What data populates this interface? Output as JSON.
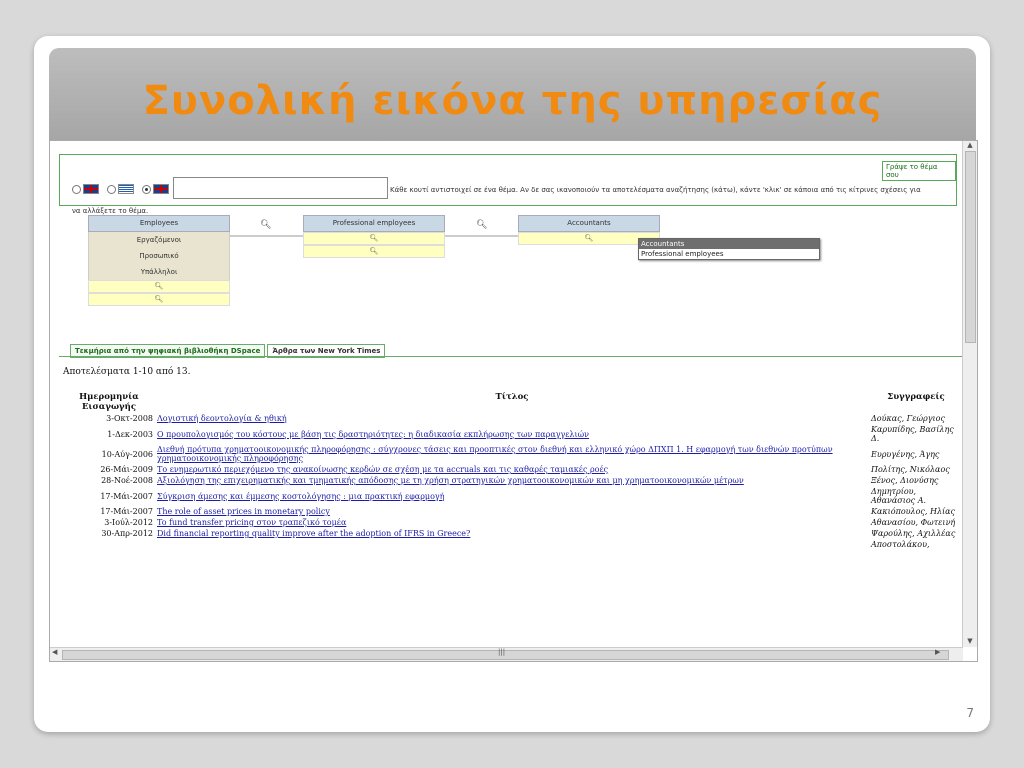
{
  "slide": {
    "title": "Συνολική εικόνα της υπηρεσίας",
    "page_number": "7"
  },
  "search": {
    "write_link": "Γράψε το θέμα σου",
    "instruction_1": "Κάθε κουτί αντιστοιχεί σε ένα θέμα. Αν δε σας ικανοποιούν τα αποτελέσματα αναζήτησης (κάτω), κάντε 'κλικ' σε κάποια από τις κίτρινες σχέσεις για",
    "instruction_2": "να αλλάξετε το θέμα.",
    "input_value": ""
  },
  "concepts": [
    {
      "header": "Employees",
      "terms": [
        "Εργαζόμενοι",
        "Προσωπικό",
        "Υπάλληλοι"
      ]
    },
    {
      "header": "Professional employees",
      "terms": []
    },
    {
      "header": "Accountants",
      "terms": []
    }
  ],
  "tooltip": {
    "title": "Accountants",
    "item": "Professional employees"
  },
  "tabs": [
    "Τεκμήρια από την ψηφιακή βιβλιοθήκη DSpace",
    "Άρθρα των New York Times"
  ],
  "results": {
    "count_text": "Αποτελέσματα 1-10 από 13.",
    "headers": {
      "date": "Ημερομηνία Εισαγωγής",
      "title": "Τίτλος",
      "authors": "Συγγραφείς"
    },
    "rows": [
      {
        "date": "3-Οκτ-2008",
        "title": "Λογιστική δεοντολογία & ηθική",
        "authors": "Δούκας, Γεώργιος"
      },
      {
        "date": "1-Δεκ-2003",
        "title": "Ο προυπολογισμός του κόστους με βάση τις δραστηριότητες: η διαδικασία εκπλήρωσης των παραγγελιών",
        "authors": "Καρυπίδης, Βασίλης Δ."
      },
      {
        "date": "10-Αύγ-2006",
        "title": "Διεθνή πρότυπα χρηματοοικονομικής πληροφόρησης : σύγχρονες τάσεις και προοπτικές στον διεθνή και ελληνικό χώρο ΔΠΧΠ 1. Η εφαρμογή των διεθνών προτύπων χρηματοοικονομικής πληροφόρησης",
        "authors": "Ευρυγένης, Άγης"
      },
      {
        "date": "26-Μάι-2009",
        "title": "Το ενημερωτικό περιεχόμενο της ανακοίνωσης κερδών σε σχέση με τα accruals και τις καθαρές ταμιακές ροές",
        "authors": "Πολίτης, Νικόλαος"
      },
      {
        "date": "28-Νοέ-2008",
        "title": "Αξιολόγηση της επιχειρηματικής και τμηματικής απόδοσης με τη χρήση στρατηγικών χρηματοοικονομικών και μη χρηματοοικονομικών μέτρων",
        "authors": "Ξένος, Διονύσης"
      },
      {
        "date": "17-Μάι-2007",
        "title": "Σύγκριση άμεσης και έμμεσης κοστολόγησης : μια πρακτική εφαρμογή",
        "authors": "Δημητρίου, Αθανάσιος Α."
      },
      {
        "date": "17-Μάι-2007",
        "title": "The role of asset prices in monetary policy",
        "authors": "Κακιόπουλος, Ηλίας"
      },
      {
        "date": "3-Ιούλ-2012",
        "title": "To fund transfer pricing στον τραπεζικό τομέα",
        "authors": "Αθανασίου, Φωτεινή"
      },
      {
        "date": "30-Απρ-2012",
        "title": "Did financial reporting quality improve after the adoption of IFRS in Greece?",
        "authors": "Ψαρούλης, Αχιλλέας"
      },
      {
        "date": "",
        "title": "",
        "authors": "Αποστολάκου,"
      }
    ]
  }
}
